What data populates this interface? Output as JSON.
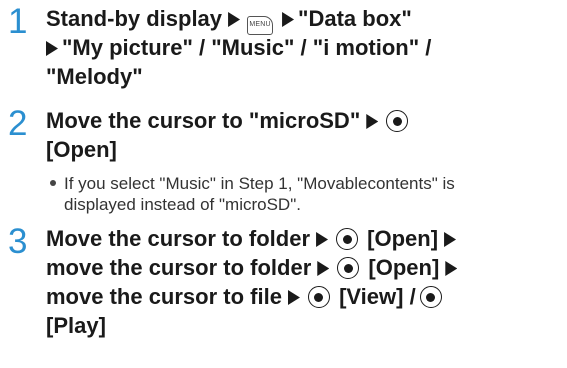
{
  "steps": [
    {
      "number": "1",
      "line1": {
        "text": "Stand-by display",
        "target": "\"Data box\""
      },
      "line2": "\"My picture\" / \"Music\" / \"i motion\" /",
      "line3": "\"Melody\""
    },
    {
      "number": "2",
      "line1": "Move the cursor to \"microSD\"",
      "line2": "[Open]",
      "note_line1": "If you select \"Music\" in Step 1, \"Movablecontents\" is",
      "note_line2": "displayed instead of \"microSD\"."
    },
    {
      "number": "3",
      "line1a": "Move the cursor to folder",
      "line1b": "[Open]",
      "line2a": "move the cursor to folder",
      "line2b": "[Open]",
      "line3a": "move the cursor to file",
      "line3b": "[View] /",
      "line4": "[Play]"
    }
  ],
  "icons": {
    "menu_key_label": "MENU"
  },
  "colors": {
    "step_number": "#2b8fd0",
    "text": "#1a1a1a"
  }
}
